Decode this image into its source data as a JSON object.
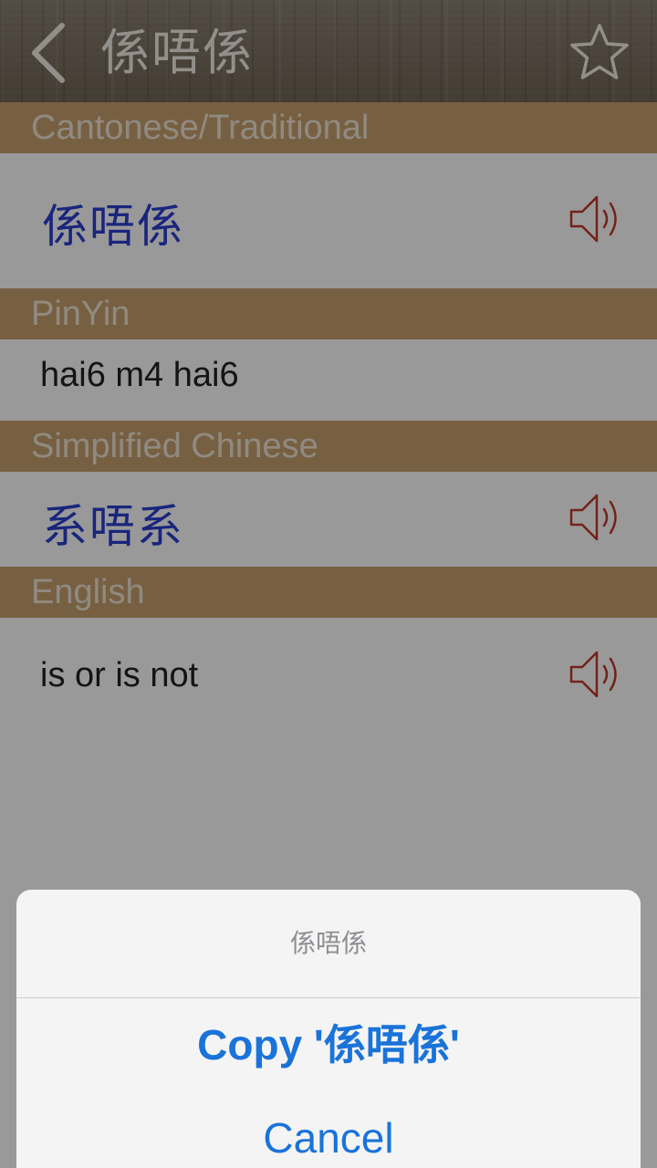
{
  "nav": {
    "title": "係唔係",
    "back_icon": "chevron-left-icon",
    "favorite_icon": "star-outline-icon"
  },
  "sections": {
    "traditional": {
      "header": "Cantonese/Traditional",
      "value": "係唔係"
    },
    "pinyin": {
      "header": "PinYin",
      "value": "hai6 m4 hai6"
    },
    "simplified": {
      "header": "Simplified Chinese",
      "value": "系唔系"
    },
    "english": {
      "header": "English",
      "value": "is or is not"
    }
  },
  "action_sheet": {
    "title": "係唔係",
    "copy_label": "Copy '係唔係'",
    "cancel_label": "Cancel"
  },
  "colors": {
    "section_header_bg": "#c6a06e",
    "chinese_text": "#2b3fd0",
    "speaker_icon": "#c0392b",
    "action_blue": "#1a73d9"
  }
}
